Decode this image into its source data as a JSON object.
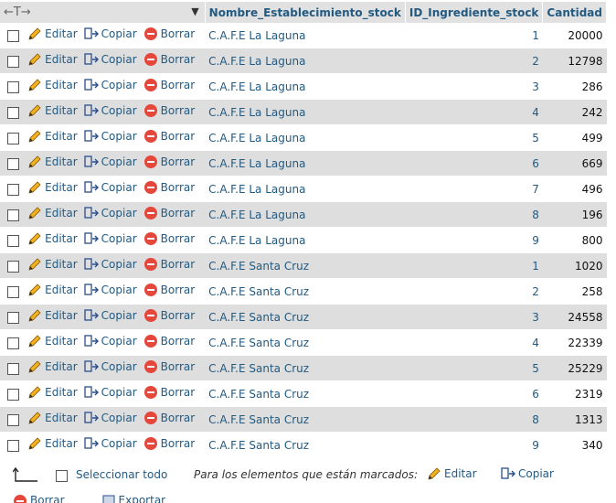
{
  "header": {
    "nav_arrows": "←T→",
    "sort_indicator": "▼",
    "columns": [
      "Nombre_Establecimiento_stock",
      "ID_Ingrediente_stock",
      "Cantidad"
    ]
  },
  "row_actions": {
    "edit": "Editar",
    "copy": "Copiar",
    "delete": "Borrar"
  },
  "rows": [
    {
      "name": "C.A.F.E La Laguna",
      "id": "1",
      "qty": "20000"
    },
    {
      "name": "C.A.F.E La Laguna",
      "id": "2",
      "qty": "12798"
    },
    {
      "name": "C.A.F.E La Laguna",
      "id": "3",
      "qty": "286"
    },
    {
      "name": "C.A.F.E La Laguna",
      "id": "4",
      "qty": "242"
    },
    {
      "name": "C.A.F.E La Laguna",
      "id": "5",
      "qty": "499"
    },
    {
      "name": "C.A.F.E La Laguna",
      "id": "6",
      "qty": "669"
    },
    {
      "name": "C.A.F.E La Laguna",
      "id": "7",
      "qty": "496"
    },
    {
      "name": "C.A.F.E La Laguna",
      "id": "8",
      "qty": "196"
    },
    {
      "name": "C.A.F.E La Laguna",
      "id": "9",
      "qty": "800"
    },
    {
      "name": "C.A.F.E Santa Cruz",
      "id": "1",
      "qty": "1020"
    },
    {
      "name": "C.A.F.E Santa Cruz",
      "id": "2",
      "qty": "258"
    },
    {
      "name": "C.A.F.E Santa Cruz",
      "id": "3",
      "qty": "24558"
    },
    {
      "name": "C.A.F.E Santa Cruz",
      "id": "4",
      "qty": "22339"
    },
    {
      "name": "C.A.F.E Santa Cruz",
      "id": "5",
      "qty": "25229"
    },
    {
      "name": "C.A.F.E Santa Cruz",
      "id": "6",
      "qty": "2319"
    },
    {
      "name": "C.A.F.E Santa Cruz",
      "id": "8",
      "qty": "1313"
    },
    {
      "name": "C.A.F.E Santa Cruz",
      "id": "9",
      "qty": "340"
    }
  ],
  "footer": {
    "select_all": "Seleccionar todo",
    "with_selected": "Para los elementos que están marcados:",
    "edit": "Editar",
    "copy": "Copiar",
    "delete_partial": "Borrar",
    "export_partial": "Exportar"
  },
  "colors": {
    "link": "#235a81",
    "row_alt": "#dedede",
    "header_bg": "#e1e1e1",
    "delete_red": "#e4473b",
    "pencil": "#f0b020"
  }
}
